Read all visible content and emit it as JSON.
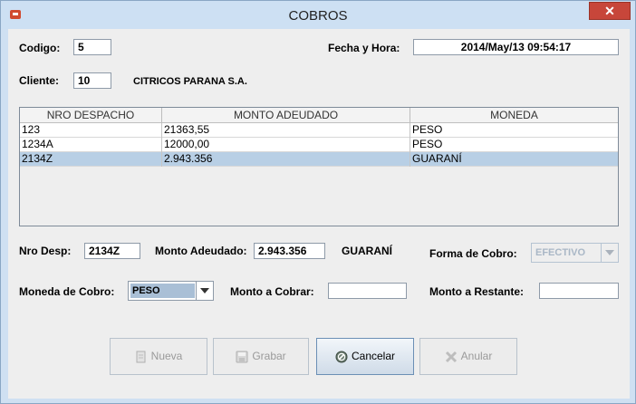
{
  "window": {
    "title": "COBROS",
    "close_glyph": "✕"
  },
  "header": {
    "codigo_label": "Codigo:",
    "codigo_value": "5",
    "fecha_label": "Fecha y Hora:",
    "fecha_value": "2014/May/13 09:54:17",
    "cliente_label": "Cliente:",
    "cliente_value": "10",
    "cliente_name": "CITRICOS PARANA S.A."
  },
  "table": {
    "columns": [
      "NRO DESPACHO",
      "MONTO ADEUDADO",
      "MONEDA"
    ],
    "rows": [
      [
        "123",
        "21363,55",
        "PESO"
      ],
      [
        "1234A",
        "12000,00",
        "PESO"
      ],
      [
        "2134Z",
        "2.943.356",
        "GUARANÍ"
      ]
    ],
    "selected_index": 2
  },
  "detail": {
    "nro_desp_label": "Nro Desp:",
    "nro_desp_value": "2134Z",
    "monto_adeudado_label": "Monto Adeudado:",
    "monto_adeudado_value": "2.943.356",
    "moneda_text": "GUARANÍ",
    "forma_cobro_label": "Forma de Cobro:",
    "forma_cobro_value": "EFECTIVO",
    "moneda_cobro_label": "Moneda de Cobro:",
    "moneda_cobro_value": "PESO",
    "monto_cobrar_label": "Monto a Cobrar:",
    "monto_cobrar_value": "",
    "monto_restante_label": "Monto a Restante:",
    "monto_restante_value": ""
  },
  "buttons": {
    "nueva": "Nueva",
    "grabar": "Grabar",
    "cancelar": "Cancelar",
    "anular": "Anular"
  },
  "colors": {
    "selection": "#b8cfe5",
    "close": "#c7463a"
  }
}
